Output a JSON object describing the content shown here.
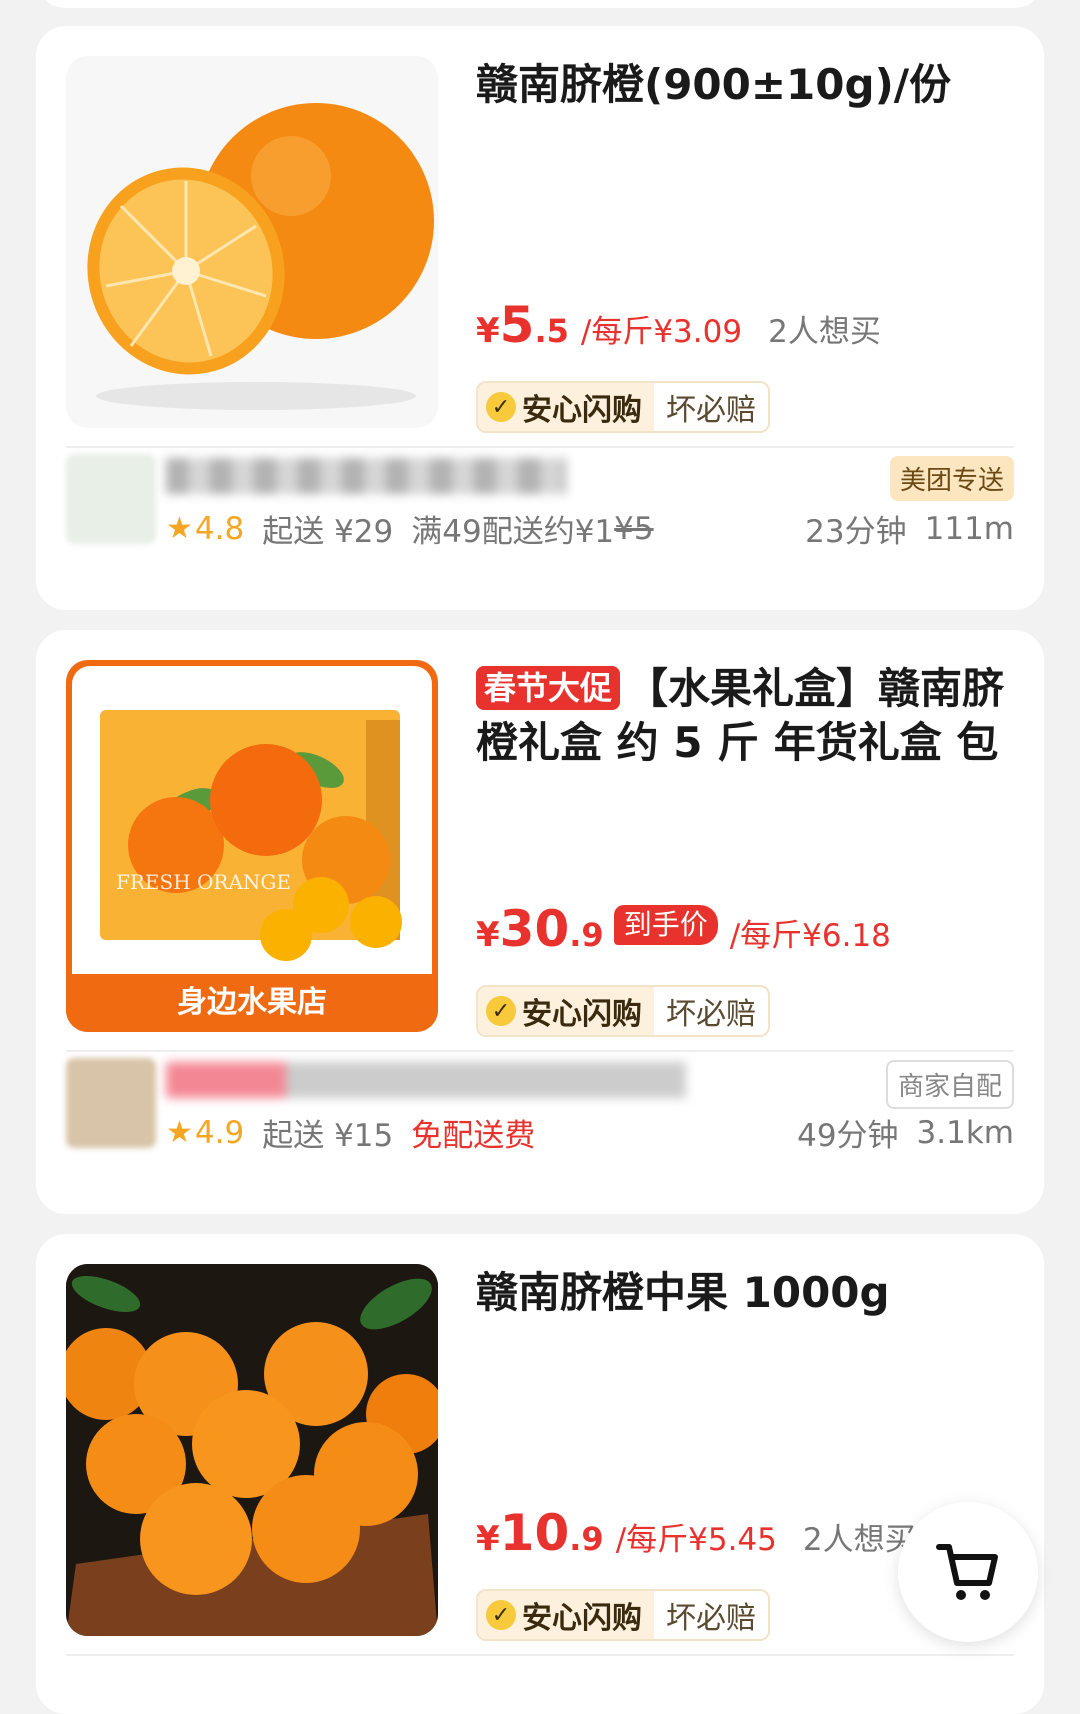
{
  "cards": [
    {
      "title": "赣南脐橙(900±10g)/份",
      "price_yen": "¥",
      "price_int": "5",
      "price_dec": ".5",
      "unit_price": "/每斤¥3.09",
      "want": "2人想买",
      "guarantee_main": "安心闪购",
      "guarantee_sub": "坏必赔",
      "shop_rating": "4.8",
      "shop_min": "起送 ¥29",
      "shop_fee_prefix": "满49配送约¥1",
      "shop_fee_old": "¥5",
      "eta": "23分钟",
      "distance": "111m",
      "delivery_tag": "美团专送"
    },
    {
      "promo_tag": "春节大促",
      "title": "【水果礼盒】赣南脐橙礼盒 约 5 斤 年货礼盒 包",
      "price_yen": "¥",
      "price_int": "30",
      "price_dec": ".9",
      "final_tag": "到手价",
      "unit_price": "/每斤¥6.18",
      "guarantee_main": "安心闪购",
      "guarantee_sub": "坏必赔",
      "image_banner": "身边水果店",
      "image_text": "FRESH ORANGE",
      "shop_rating": "4.9",
      "shop_min": "起送 ¥15",
      "shop_fee": "免配送费",
      "eta": "49分钟",
      "distance": "3.1km",
      "delivery_tag": "商家自配"
    },
    {
      "title": "赣南脐橙中果 1000g",
      "price_yen": "¥",
      "price_int": "10",
      "price_dec": ".9",
      "unit_price": "/每斤¥5.45",
      "want": "2人想买",
      "guarantee_main": "安心闪购",
      "guarantee_sub": "坏必赔"
    }
  ],
  "icons": {
    "check": "✓",
    "star": "★",
    "cart": "cart-icon"
  },
  "colors": {
    "accent": "#e8322d",
    "guarantee_bg": "#fdf1dd",
    "rating": "#f5a623"
  }
}
